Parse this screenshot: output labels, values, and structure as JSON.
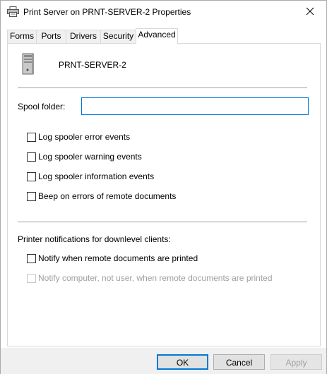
{
  "window": {
    "title": "Print Server on PRNT-SERVER-2 Properties"
  },
  "tabs": [
    {
      "label": "Forms"
    },
    {
      "label": "Ports"
    },
    {
      "label": "Drivers"
    },
    {
      "label": "Security"
    },
    {
      "label": "Advanced",
      "active": true
    }
  ],
  "server": {
    "name": "PRNT-SERVER-2"
  },
  "spool": {
    "label": "Spool folder:",
    "value": ""
  },
  "log_options": [
    {
      "label": "Log spooler error events",
      "checked": false
    },
    {
      "label": "Log spooler warning events",
      "checked": false
    },
    {
      "label": "Log spooler information events",
      "checked": false
    },
    {
      "label": "Beep on errors of remote documents",
      "checked": false
    }
  ],
  "notifications": {
    "heading": "Printer notifications for downlevel clients:",
    "options": [
      {
        "label": "Notify when remote documents are printed",
        "checked": false,
        "enabled": true
      },
      {
        "label": "Notify computer, not user, when remote documents are printed",
        "checked": false,
        "enabled": false
      }
    ]
  },
  "buttons": {
    "ok": "OK",
    "cancel": "Cancel",
    "apply": "Apply"
  },
  "colors": {
    "accent": "#0078d7",
    "disabled_text": "#a0a0a0",
    "footer_bg": "#f0f0f0"
  },
  "icons": {
    "title": "printer-icon",
    "server": "server-tower-icon",
    "close": "close-icon"
  }
}
